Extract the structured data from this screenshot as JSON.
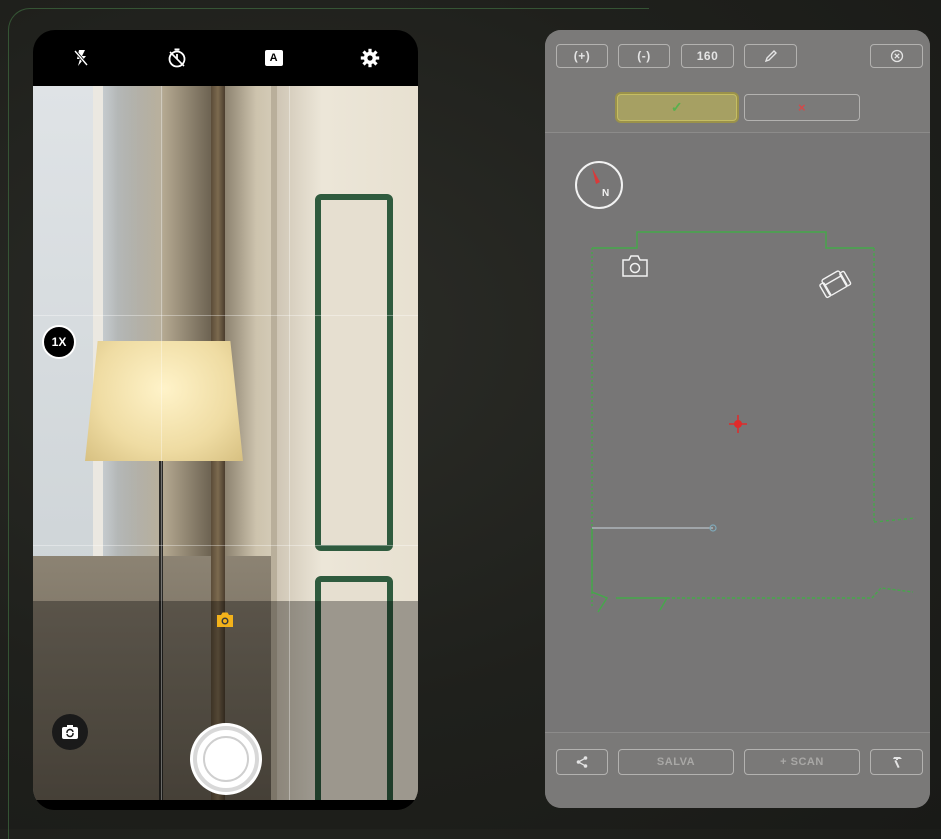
{
  "camera": {
    "topbar": {
      "flash_icon": "flash-off-icon",
      "timer_icon": "timer-icon",
      "auto_icon": "auto-mode-icon",
      "auto_label": "A",
      "settings_icon": "gear-icon"
    },
    "zoom_label": "1X",
    "mode_icon": "camera-icon",
    "mode_color": "#f3b21a",
    "switch_icon": "switch-camera-icon",
    "shutter_icon": "shutter-button"
  },
  "editor": {
    "toolbar": {
      "zoom_in_label": "(+)",
      "zoom_out_label": "(-)",
      "value_label": "160",
      "pencil_icon": "pencil-icon",
      "close_icon": "close-circle-icon",
      "confirm_label": "✓",
      "cancel_label": "×"
    },
    "canvas": {
      "compass_label": "N",
      "camera_icon": "camera-icon",
      "furniture_icon": "armchair-icon",
      "target_icon": "crosshair-icon",
      "wall_color": "#45a84a",
      "target_color": "#e02a2a"
    },
    "bottombar": {
      "share_icon": "share-icon",
      "save_label": "SALVA",
      "scan_label": "+ SCAN",
      "tools_icon": "hammer-icon"
    }
  }
}
